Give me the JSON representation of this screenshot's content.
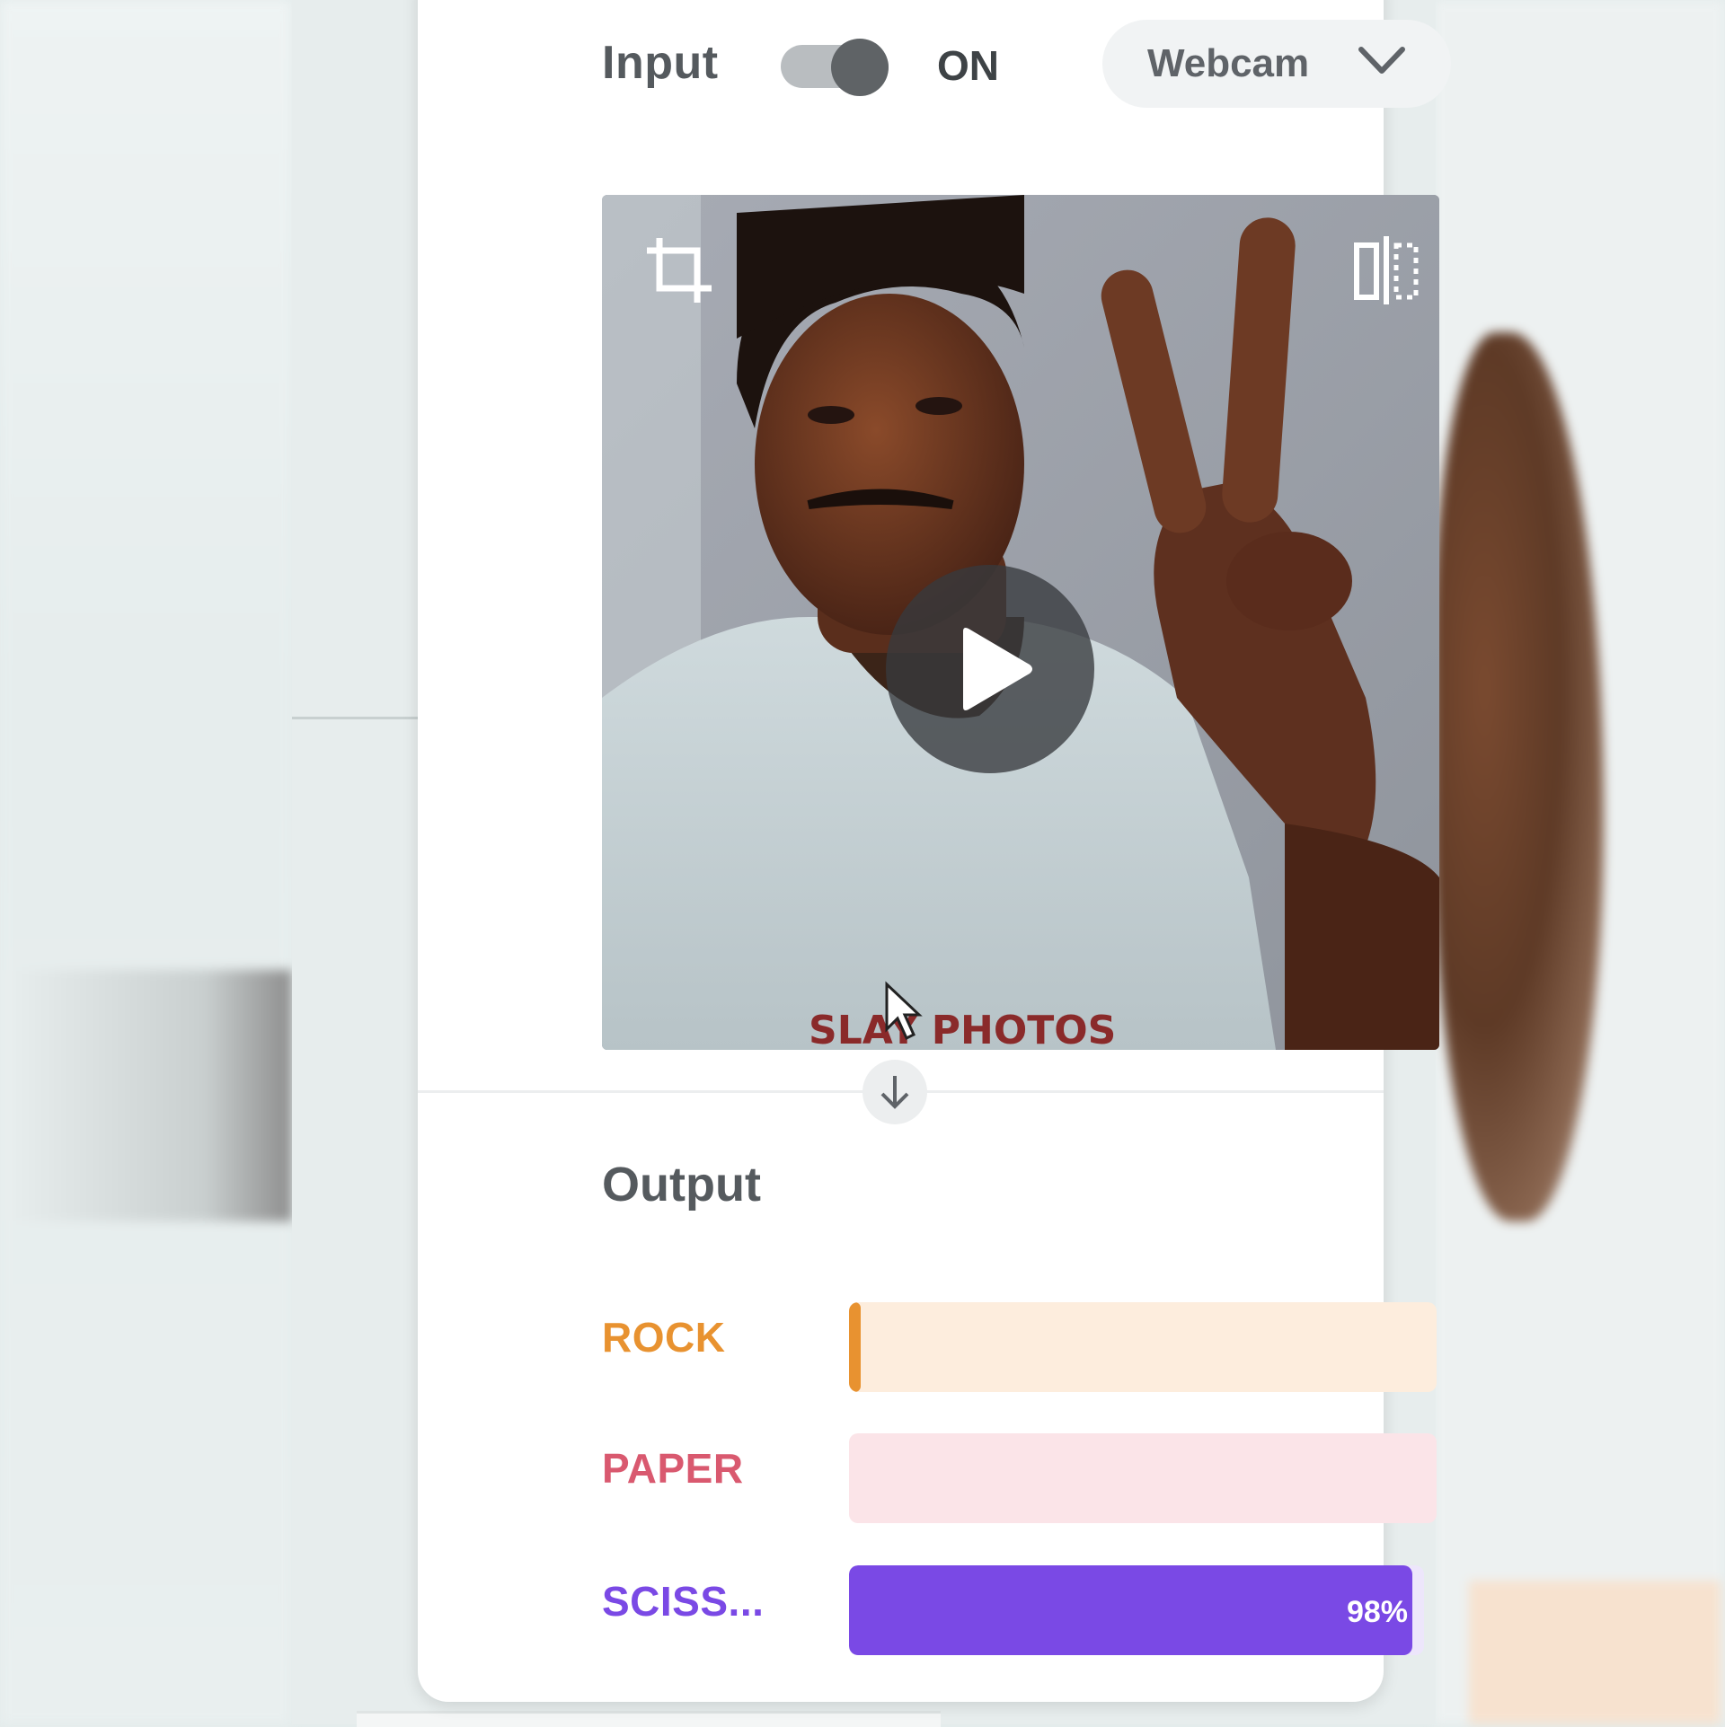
{
  "input": {
    "label": "Input",
    "toggle_state": "ON",
    "source": "Webcam"
  },
  "preview": {
    "shirt_text": "SLAY PHOTOS"
  },
  "output": {
    "title": "Output",
    "classes": [
      {
        "label": "ROCK",
        "color": "#e89230",
        "track_color": "#fdeddd",
        "confidence": 0.01,
        "percent_text": ""
      },
      {
        "label": "PAPER",
        "color": "#d9596f",
        "track_color": "#fbe4e8",
        "confidence": 0.0,
        "percent_text": ""
      },
      {
        "label": "SCISS...",
        "color": "#7a49e5",
        "track_color": "#ede6fb",
        "confidence": 0.98,
        "percent_text": "98%"
      }
    ]
  },
  "icons": [
    "crop-icon",
    "flip-icon",
    "play-icon",
    "chevron-down-icon",
    "arrow-down-icon",
    "cursor-icon"
  ]
}
